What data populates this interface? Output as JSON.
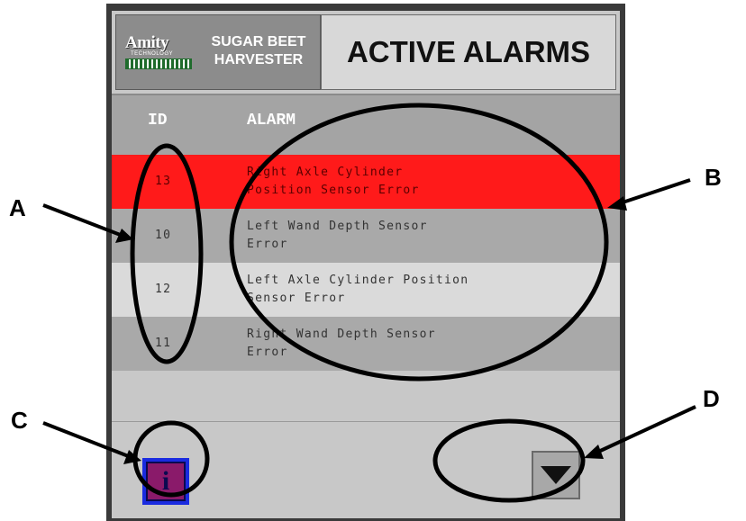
{
  "header": {
    "logo_word": "Amity",
    "logo_sub": "TECHNOLOGY",
    "brand_line1": "SUGAR BEET",
    "brand_line2": "HARVESTER",
    "title": "ACTIVE ALARMS"
  },
  "table": {
    "columns": {
      "id": "ID",
      "alarm": "ALARM"
    },
    "rows": [
      {
        "id": "13",
        "alarm": "Right Axle Cylinder\nPosition Sensor Error",
        "status": "active",
        "color": "#ff1a1a"
      },
      {
        "id": "10",
        "alarm": "Left Wand Depth Sensor\nError",
        "color": "#a9a9a9"
      },
      {
        "id": "12",
        "alarm": "Left Axle Cylinder Position\nSensor Error",
        "color": "#dadada"
      },
      {
        "id": "11",
        "alarm": "Right Wand Depth Sensor\nError",
        "color": "#a9a9a9"
      }
    ]
  },
  "footer": {
    "info_icon": "info-icon",
    "info_glyph": "i",
    "down_icon": "arrow-down-icon"
  },
  "annotations": {
    "a": "A",
    "b": "B",
    "c": "C",
    "d": "D"
  }
}
